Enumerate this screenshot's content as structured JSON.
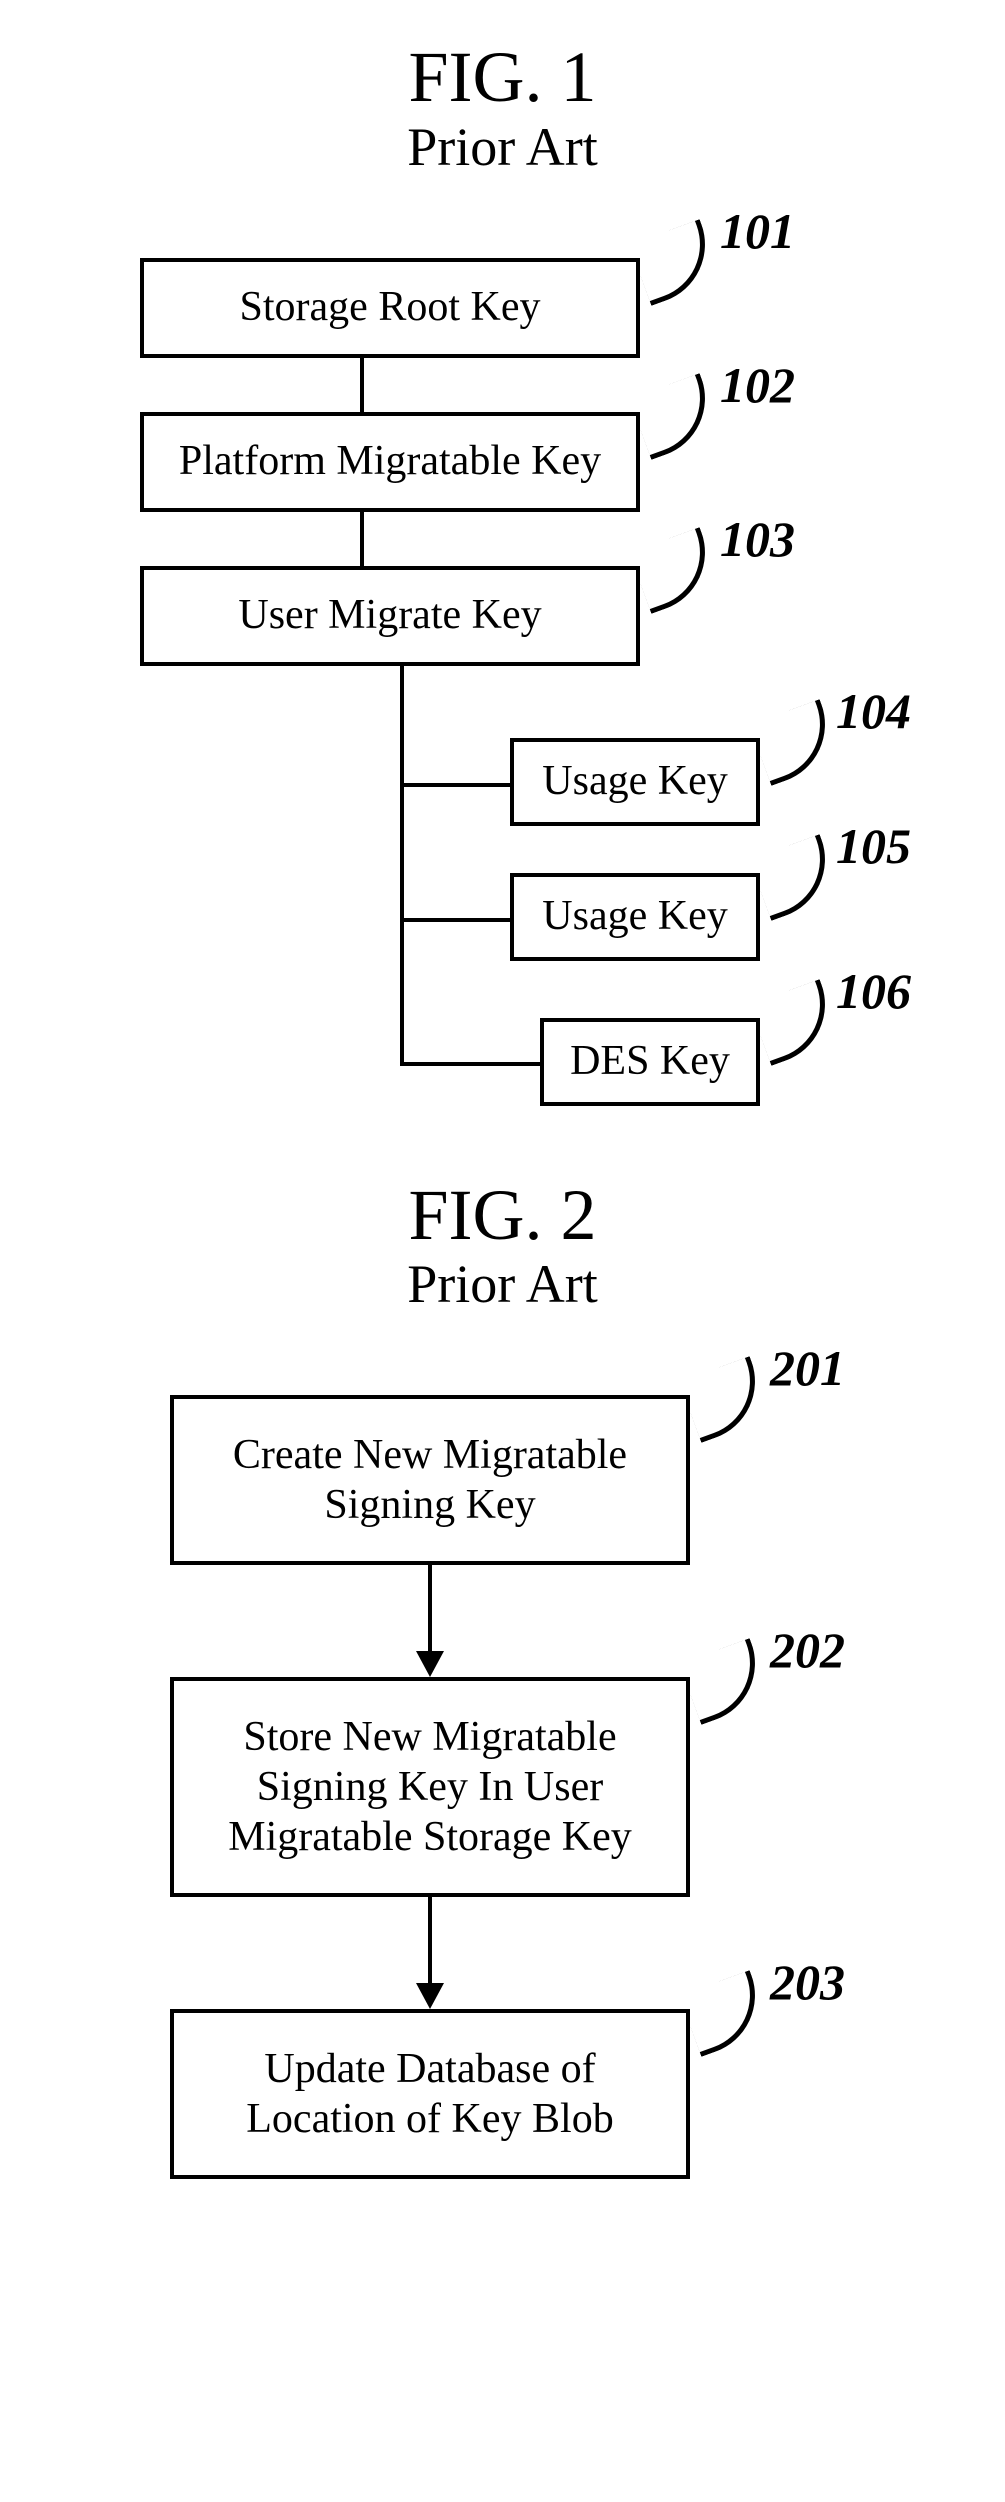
{
  "fig1": {
    "title": "FIG. 1",
    "subtitle": "Prior Art",
    "nodes": {
      "n101": {
        "label": "Storage Root Key",
        "ref": "101"
      },
      "n102": {
        "label": "Platform Migratable Key",
        "ref": "102"
      },
      "n103": {
        "label": "User Migrate Key",
        "ref": "103"
      },
      "n104": {
        "label": "Usage Key",
        "ref": "104"
      },
      "n105": {
        "label": "Usage Key",
        "ref": "105"
      },
      "n106": {
        "label": "DES Key",
        "ref": "106"
      }
    }
  },
  "fig2": {
    "title": "FIG. 2",
    "subtitle": "Prior Art",
    "steps": {
      "s201": {
        "label": "Create New Migratable\nSigning Key",
        "ref": "201"
      },
      "s202": {
        "label": "Store New Migratable\nSigning Key In User\nMigratable Storage Key",
        "ref": "202"
      },
      "s203": {
        "label": "Update Database of\nLocation of Key Blob",
        "ref": "203"
      }
    }
  }
}
